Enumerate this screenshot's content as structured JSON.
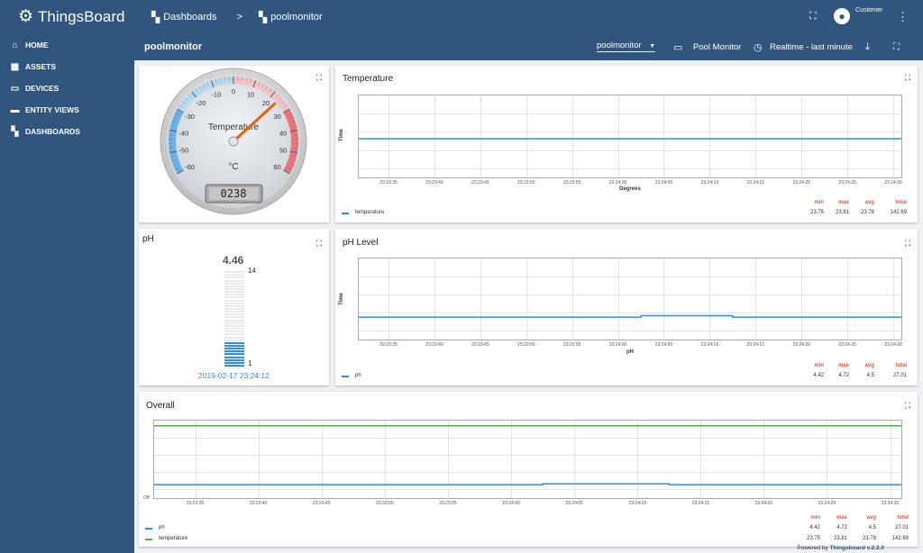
{
  "app": {
    "logo_text": "ThingsBoard"
  },
  "sidebar": {
    "items": [
      {
        "label": "HOME",
        "icon": "home-icon"
      },
      {
        "label": "ASSETS",
        "icon": "assets-icon"
      },
      {
        "label": "DEVICES",
        "icon": "devices-icon"
      },
      {
        "label": "ENTITY VIEWS",
        "icon": "entity-views-icon"
      },
      {
        "label": "DASHBOARDS",
        "icon": "dashboards-icon"
      }
    ]
  },
  "header": {
    "breadcrumb_root": "Dashboards",
    "breadcrumb_sep": ">",
    "breadcrumb_current": "poolmonitor",
    "user_role": "Customer"
  },
  "subheader": {
    "title": "poolmonitor",
    "state_select": "poolmonitor",
    "entity_label": "Pool Monitor",
    "timewindow": "Realtime - last minute"
  },
  "gauge": {
    "title": "Temperature",
    "unit": "°C",
    "value": 23.8,
    "lcd_value": "0238",
    "min": -60,
    "max": 60,
    "ticks": [
      "-60",
      "-50",
      "-40",
      "-30",
      "-20",
      "-10",
      "0",
      "10",
      "20",
      "30",
      "40",
      "50",
      "60"
    ]
  },
  "ph_widget": {
    "title": "pH",
    "value": "4.46",
    "max_label": "14",
    "min_label": "1",
    "level_fraction": 0.26,
    "timestamp": "2019-02-17 23:24:12"
  },
  "temp_chart": {
    "title": "Temperature",
    "ylabel": "Time",
    "xlabel": "Degrees",
    "x_ticks": [
      "23:23:35",
      "23:23:40",
      "23:23:45",
      "23:23:50",
      "23:23:55",
      "23:24:00",
      "23:24:05",
      "23:24:10",
      "23:24:15",
      "23:24:20",
      "23:24:25",
      "23:24:30"
    ],
    "legend_headers": [
      "min",
      "max",
      "avg",
      "total"
    ],
    "series_name": "temperature",
    "stats": [
      "23.75",
      "23.81",
      "23.78",
      "142.69"
    ],
    "color": "#2f8fde"
  },
  "ph_chart": {
    "title": "pH Level",
    "ylabel": "Time",
    "xlabel": "pH",
    "x_ticks": [
      "23:23:35",
      "23:23:40",
      "23:23:45",
      "23:23:50",
      "23:23:55",
      "23:24:00",
      "23:24:05",
      "23:24:10",
      "23:24:15",
      "23:24:20",
      "23:24:25",
      "23:24:30"
    ],
    "legend_headers": [
      "min",
      "max",
      "avg",
      "total"
    ],
    "series_name": "ph",
    "stats": [
      "4.42",
      "4.72",
      "4.5",
      "27.01"
    ],
    "color": "#2f8fde"
  },
  "overall_chart": {
    "title": "Overall",
    "y_tick": "Off",
    "x_ticks": [
      "23:23:35",
      "23:23:40",
      "23:23:45",
      "23:23:50",
      "23:23:55",
      "23:24:00",
      "23:24:05",
      "23:24:10",
      "23:24:15",
      "23:24:20",
      "23:24:25",
      "23:24:30"
    ],
    "legend_headers": [
      "min",
      "max",
      "avg",
      "total"
    ],
    "series": [
      {
        "name": "ph",
        "color": "#2f8fde",
        "stats": [
          "4.42",
          "4.72",
          "4.5",
          "27.01"
        ]
      },
      {
        "name": "temperature",
        "color": "#4caf50",
        "stats": [
          "23.75",
          "23.81",
          "23.78",
          "142.69"
        ]
      }
    ]
  },
  "chart_data": [
    {
      "type": "line",
      "title": "Temperature",
      "xlabel": "Degrees",
      "ylabel": "Time",
      "x": [
        "23:23:35",
        "23:23:40",
        "23:23:45",
        "23:23:50",
        "23:23:55",
        "23:24:00",
        "23:24:05",
        "23:24:10",
        "23:24:15",
        "23:24:20",
        "23:24:25",
        "23:24:30"
      ],
      "series": [
        {
          "name": "temperature",
          "values": [
            23.78,
            23.78,
            23.78,
            23.78,
            23.78,
            23.78,
            23.78,
            23.78,
            23.78,
            23.78,
            23.78,
            23.78
          ]
        }
      ]
    },
    {
      "type": "line",
      "title": "pH Level",
      "xlabel": "pH",
      "ylabel": "Time",
      "x": [
        "23:23:35",
        "23:23:40",
        "23:23:45",
        "23:23:50",
        "23:23:55",
        "23:24:00",
        "23:24:05",
        "23:24:10",
        "23:24:15",
        "23:24:20",
        "23:24:25",
        "23:24:30"
      ],
      "series": [
        {
          "name": "ph",
          "values": [
            4.42,
            4.42,
            4.42,
            4.42,
            4.42,
            4.42,
            4.72,
            4.72,
            4.42,
            4.42,
            4.42,
            4.42
          ]
        }
      ]
    },
    {
      "type": "line",
      "title": "Overall",
      "x": [
        "23:23:35",
        "23:23:40",
        "23:23:45",
        "23:23:50",
        "23:23:55",
        "23:24:00",
        "23:24:05",
        "23:24:10",
        "23:24:15",
        "23:24:20",
        "23:24:25",
        "23:24:30"
      ],
      "series": [
        {
          "name": "ph",
          "values": [
            4.42,
            4.42,
            4.42,
            4.42,
            4.42,
            4.42,
            4.72,
            4.72,
            4.42,
            4.42,
            4.42,
            4.42
          ]
        },
        {
          "name": "temperature",
          "values": [
            23.78,
            23.78,
            23.78,
            23.78,
            23.78,
            23.78,
            23.78,
            23.78,
            23.78,
            23.78,
            23.78,
            23.78
          ]
        }
      ]
    }
  ],
  "footer": {
    "powered_prefix": "Powered by",
    "powered_link": "Thingsboard v.2.2.0"
  }
}
